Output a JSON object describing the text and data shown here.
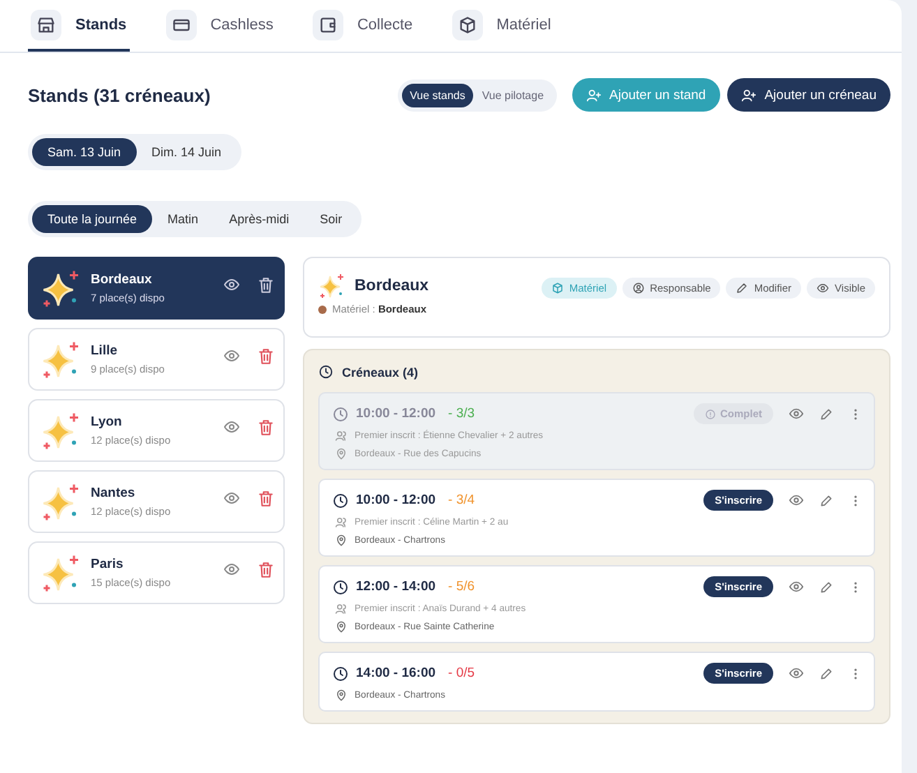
{
  "tabs": [
    {
      "label": "Stands",
      "selected": true
    },
    {
      "label": "Cashless",
      "selected": false
    },
    {
      "label": "Collecte",
      "selected": false
    },
    {
      "label": "Matériel",
      "selected": false
    }
  ],
  "title": "Stands (31 créneaux)",
  "view_toggle": [
    {
      "label": "Vue stands",
      "selected": true
    },
    {
      "label": "Vue pilotage",
      "selected": false
    }
  ],
  "actions": [
    {
      "label": "Ajouter un stand",
      "kind": "secondary"
    },
    {
      "label": "Ajouter un créneau",
      "kind": "primary"
    }
  ],
  "days": [
    {
      "label": "Sam. 13 Juin",
      "selected": true
    },
    {
      "label": "Dim. 14 Juin",
      "selected": false
    }
  ],
  "periods": [
    {
      "label": "Toute la journée",
      "selected": true
    },
    {
      "label": "Matin",
      "selected": false
    },
    {
      "label": "Après-midi",
      "selected": false
    },
    {
      "label": "Soir",
      "selected": false
    }
  ],
  "stands": [
    {
      "name": "Bordeaux",
      "places": "7 place(s) dispo",
      "selected": true
    },
    {
      "name": "Lille",
      "places": "9 place(s) dispo",
      "selected": false
    },
    {
      "name": "Lyon",
      "places": "12 place(s) dispo",
      "selected": false
    },
    {
      "name": "Nantes",
      "places": "12 place(s) dispo",
      "selected": false
    },
    {
      "name": "Paris",
      "places": "15 place(s) dispo",
      "selected": false
    }
  ],
  "detail": {
    "name": "Bordeaux",
    "material_label": "Matériel :",
    "material_value": "Bordeaux",
    "chips": [
      {
        "label": "Matériel",
        "kind": "accent"
      },
      {
        "label": "Responsable",
        "kind": "plain"
      },
      {
        "label": "Modifier",
        "kind": "plain"
      },
      {
        "label": "Visible",
        "kind": "plain"
      }
    ]
  },
  "slots_title": "Créneaux (4)",
  "slots": [
    {
      "time": "10:00 - 12:00",
      "count": "- 3/3",
      "color": "#4caf50",
      "kind": "full",
      "status": "Complet",
      "first": "Premier inscrit : Étienne Chevalier + 2 autres",
      "place": "Bordeaux - Rue des Capucins"
    },
    {
      "time": "10:00 - 12:00",
      "count": "- 3/4",
      "color": "#f0922b",
      "kind": "open",
      "status": "S'inscrire",
      "first": "Premier inscrit : Céline Martin + 2 au",
      "place": "Bordeaux - Chartrons"
    },
    {
      "time": "12:00 - 14:00",
      "count": "- 5/6",
      "color": "#f0922b",
      "kind": "open",
      "status": "S'inscrire",
      "first": "Premier inscrit : Anaïs Durand + 4 autres",
      "place": "Bordeaux - Rue Sainte Catherine"
    },
    {
      "time": "14:00 - 16:00",
      "count": "- 0/5",
      "color": "#e53945",
      "kind": "open",
      "status": "S'inscrire",
      "place": "Bordeaux - Chartrons"
    }
  ]
}
